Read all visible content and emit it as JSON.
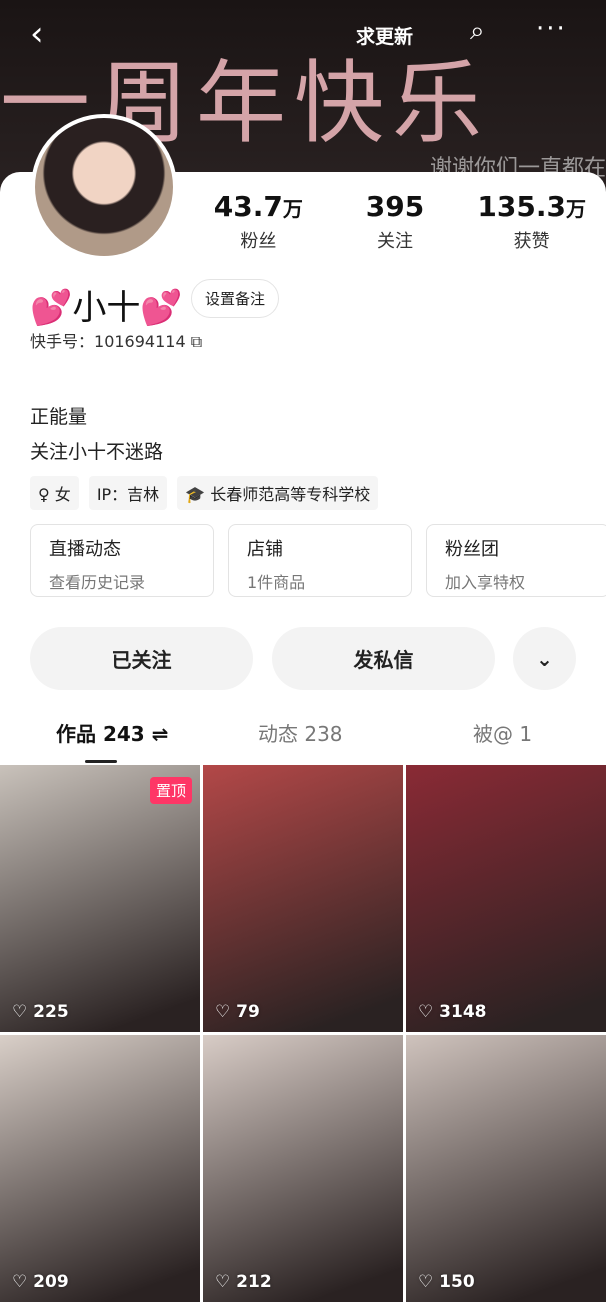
{
  "banner": {
    "text": "一周年快乐",
    "sub": "谢谢你们一直都在"
  },
  "topbar": {
    "back": "‹",
    "request_update": "求更新",
    "search": "⌕",
    "more": "···"
  },
  "stats": [
    {
      "value": "43.7",
      "unit": "万",
      "label": "粉丝"
    },
    {
      "value": "395",
      "unit": "",
      "label": "关注"
    },
    {
      "value": "135.3",
      "unit": "万",
      "label": "获赞"
    }
  ],
  "profile": {
    "heart": "💕",
    "name": "小十",
    "remark_button": "设置备注",
    "id_label": "快手号：",
    "id": "101694114",
    "copy_icon": "⧉",
    "bio1": "正能量",
    "bio2": "关注小十不迷路",
    "tags": [
      "♀ 女",
      "IP：吉林",
      "🎓 长春师范高等专科学校"
    ]
  },
  "boxes": [
    {
      "title": "直播动态",
      "sub": "查看历史记录"
    },
    {
      "title": "店铺",
      "sub": "1件商品"
    },
    {
      "title": "粉丝团",
      "sub": "加入享特权"
    }
  ],
  "actions": {
    "followed": "已关注",
    "message": "发私信",
    "more": "⌄"
  },
  "tabs": {
    "works": "作品 243 ⇌",
    "moments": "动态 238",
    "mentions": "被@ 1"
  },
  "posts": [
    {
      "likes": "225",
      "pinned": "置顶",
      "color": "#c9c2bb"
    },
    {
      "likes": "79",
      "color": "#b34848"
    },
    {
      "likes": "3148",
      "color": "#8a2a35"
    },
    {
      "likes": "209",
      "color": "#d9cfc8"
    },
    {
      "likes": "212",
      "color": "#d8ccc6"
    },
    {
      "likes": "150",
      "color": "#cfc3bd"
    }
  ],
  "heart_icon": "♡"
}
